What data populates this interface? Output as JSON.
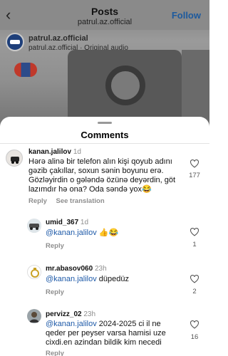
{
  "post_header": {
    "title": "Posts",
    "subtitle": "patrul.az.official",
    "follow_label": "Follow",
    "username": "patrul.az.official",
    "audio": "patrul.az.official · Original audio"
  },
  "sheet": {
    "title": "Comments"
  },
  "comments": [
    {
      "username": "kanan.jalilov",
      "time": "1d",
      "text": "Hərə alinə bir telefon alın kişi qoyub adını gəzib çakıllar, soxun sənin boyunu erə. Gözləyirdin o gələndə özünə deyərdin, göt lazımdır hə ona? Oda səndə yox😂",
      "reply_label": "Reply",
      "translation_label": "See translation",
      "likes": "177"
    },
    {
      "username": "umid_367",
      "time": "1d",
      "mention": "@kanan.jalilov",
      "text": " 👍😂",
      "reply_label": "Reply",
      "likes": "1"
    },
    {
      "username": "mr.abasov060",
      "time": "23h",
      "mention": "@kanan.jalilov",
      "text": " düpedüz",
      "reply_label": "Reply",
      "likes": "2"
    },
    {
      "username": "pervizz_02",
      "time": "23h",
      "mention": "@kanan.jalilov",
      "text": " 2024-2025 ci il ne qeder per peyser varsa hamisi uze cixdi.en azindan bildik kim necedi",
      "reply_label": "Reply",
      "likes": "16"
    }
  ],
  "colors": {
    "mention": "#1e5aa8",
    "follow": "#1d5a9e",
    "muted": "#8e8e8e"
  }
}
